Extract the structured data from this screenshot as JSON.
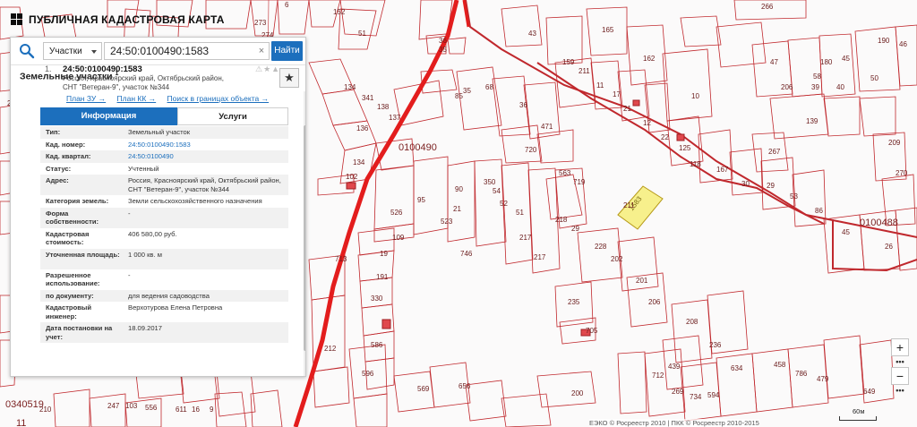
{
  "brand": {
    "title": "ПУБЛИЧНАЯ КАДАСТРОВАЯ КАРТА"
  },
  "search": {
    "scope": "Участки",
    "query": "24:50:0100490:1583",
    "clear": "×",
    "button": "Найти"
  },
  "results": {
    "section_title": "Земельные участки",
    "count": "1",
    "favorite_icon": "★",
    "item": {
      "index": "1.",
      "cad_number": "24:50:0100490:1583",
      "address_line1": "Россия, Красноярский край, Октябрьский район,",
      "address_line2": "СНТ \"Ветеран-9\", участок №344",
      "tools": "⚠★▲",
      "links": [
        "План ЗУ →",
        "План КК →",
        "Поиск в границах объекта →"
      ]
    },
    "tabs": [
      "Информация",
      "Услуги"
    ],
    "rows": [
      {
        "key": "Тип:",
        "value": "Земельный участок"
      },
      {
        "key": "Кад. номер:",
        "value": "24:50:0100490:1583",
        "link": true
      },
      {
        "key": "Кад. квартал:",
        "value": "24:50:0100490",
        "link": true
      },
      {
        "key": "Статус:",
        "value": "Учтенный"
      },
      {
        "key": "Адрес:",
        "value": "Россия, Красноярский край, Октябрьский район, СНТ \"Ветеран-9\", участок №344"
      },
      {
        "key": "Категория земель:",
        "value": "Земли сельскохозяйственного назначения"
      },
      {
        "key": "Форма собственности:",
        "value": "-"
      },
      {
        "key": "Кадастровая стоимость:",
        "value": "406 580,00 руб."
      },
      {
        "key": "Уточненная площадь:",
        "value": "1 000 кв. м"
      },
      {
        "key": "Разрешенное использование:",
        "value": "-"
      },
      {
        "key": "по документу:",
        "value": "для ведения садоводства"
      },
      {
        "key": "Кадастровый инженер:",
        "value": "Верхотурова Елена Петровна"
      },
      {
        "key": "Дата постановки на учет:",
        "value": "18.09.2017"
      }
    ]
  },
  "map": {
    "quarters": [
      "0100490",
      "0100488",
      "0340519",
      "11"
    ],
    "highlight_parcel": "1583",
    "parcel_labels": [
      "152",
      "273",
      "274",
      "6",
      "51",
      "36",
      "35",
      "35",
      "43",
      "165",
      "266",
      "47",
      "58",
      "50",
      "162",
      "159",
      "211",
      "11",
      "17",
      "10",
      "21",
      "12",
      "22",
      "125",
      "118",
      "167",
      "30",
      "29",
      "53",
      "86",
      "45",
      "26",
      "139",
      "267",
      "209",
      "270",
      "206",
      "39",
      "40",
      "180",
      "45",
      "190",
      "46",
      "122",
      "28",
      "134",
      "341",
      "138",
      "137",
      "136",
      "134",
      "102",
      "85",
      "68",
      "36",
      "471",
      "720",
      "563",
      "719",
      "218",
      "29",
      "228",
      "202",
      "201",
      "206",
      "208",
      "236",
      "235",
      "705",
      "439",
      "712",
      "200",
      "269",
      "734",
      "594",
      "634",
      "458",
      "786",
      "479",
      "649",
      "569",
      "656",
      "596",
      "586",
      "330",
      "191",
      "19",
      "109",
      "526",
      "95",
      "523",
      "90",
      "21",
      "350",
      "54",
      "52",
      "51",
      "217",
      "217",
      "746",
      "713",
      "212",
      "211",
      "210",
      "247",
      "103",
      "556",
      "1583",
      "611",
      "16",
      "9",
      "5",
      "4",
      "3",
      "2",
      "1"
    ]
  },
  "zoom": {
    "in": "+",
    "out": "−",
    "more1": "•••",
    "more2": "•••"
  },
  "copyright": "ЕЭКО © Росреестр 2010 | ПКК © Росреестр 2010-2015",
  "scale": "60м",
  "colors": {
    "accent": "#1c6fbd",
    "parcel_line": "#c0282d",
    "road": "#e31d1d",
    "highlight": "#f7f08c"
  }
}
